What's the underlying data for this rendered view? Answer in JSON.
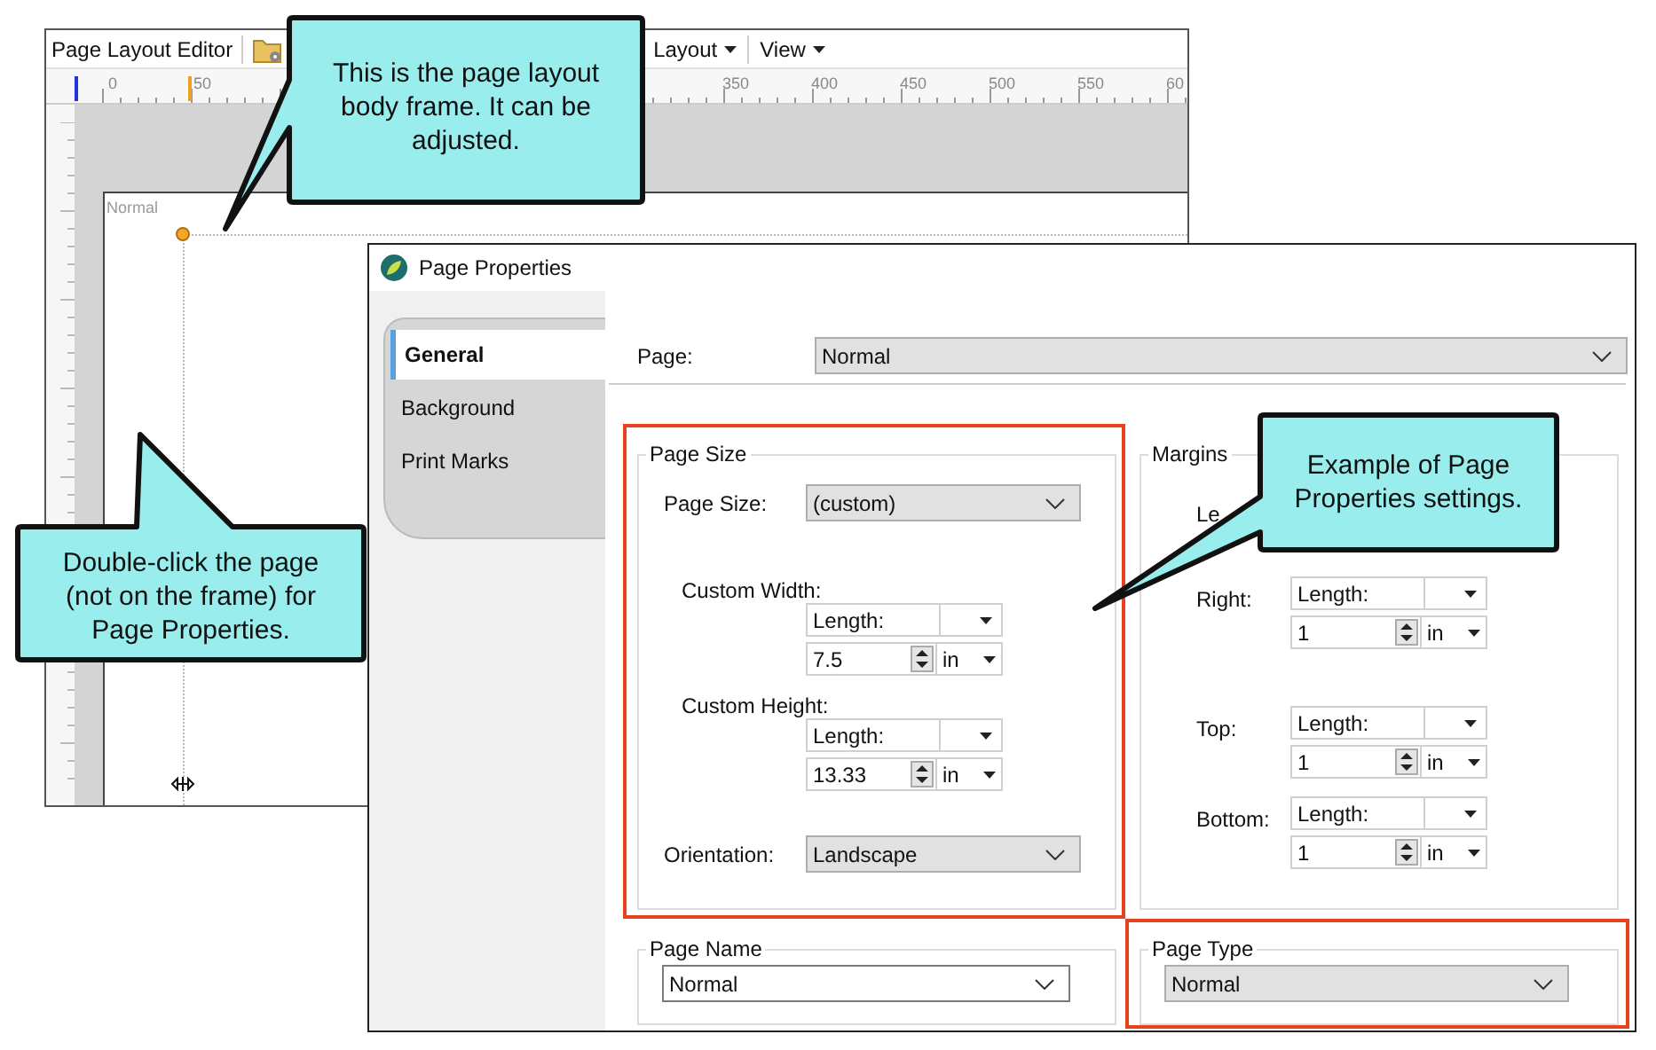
{
  "editor": {
    "title": "Page Layout Editor",
    "menus": [
      {
        "label": "Layout"
      },
      {
        "label": "View"
      }
    ],
    "ruler_labels": [
      "0",
      "50",
      "350",
      "400",
      "450",
      "500",
      "550",
      "60"
    ],
    "page_label": "Normal"
  },
  "dialog": {
    "title": "Page Properties",
    "tabs": [
      {
        "label": "General",
        "selected": true
      },
      {
        "label": "Background",
        "selected": false
      },
      {
        "label": "Print Marks",
        "selected": false
      }
    ],
    "page": {
      "label": "Page:",
      "value": "Normal"
    },
    "page_size": {
      "title": "Page Size",
      "highlighted": true,
      "size_label": "Page Size:",
      "size_value": "(custom)",
      "width": {
        "label": "Custom Width:",
        "mode": "Length:",
        "value": "7.5",
        "unit": "in"
      },
      "height": {
        "label": "Custom Height:",
        "mode": "Length:",
        "value": "13.33",
        "unit": "in"
      },
      "orientation": {
        "label": "Orientation:",
        "value": "Landscape"
      }
    },
    "margins": {
      "title": "Margins",
      "highlighted": false,
      "rows": [
        {
          "label": "Le"
        },
        {
          "label": "Right:",
          "mode": "Length:",
          "value": "1",
          "unit": "in"
        },
        {
          "label": "Top:",
          "mode": "Length:",
          "value": "1",
          "unit": "in"
        },
        {
          "label": "Bottom:",
          "mode": "Length:",
          "value": "1",
          "unit": "in"
        }
      ]
    },
    "page_name": {
      "title": "Page Name",
      "highlighted": false,
      "value": "Normal"
    },
    "page_type": {
      "title": "Page Type",
      "highlighted": true,
      "value": "Normal"
    }
  },
  "callouts": [
    {
      "text": "This is the page layout body frame. It can be adjusted."
    },
    {
      "text": "Example of Page Properties settings."
    },
    {
      "text": "Double-click the page (not on the frame) for Page Properties."
    }
  ]
}
